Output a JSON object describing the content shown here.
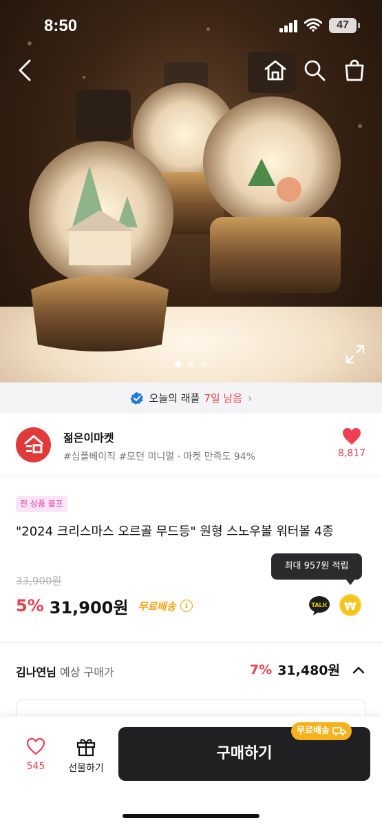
{
  "status": {
    "time": "8:50",
    "battery": "47"
  },
  "hero": {
    "carousel_count": 3,
    "active_index": 0
  },
  "raffle": {
    "text": "오늘의 래플",
    "days_left": "7일 남음"
  },
  "shop": {
    "name": "젊은이마켓",
    "tags": "#심플베이직 #모던 미니멀 · 마켓 만족도 94%",
    "likes": "8,817"
  },
  "product": {
    "promo_badge": "전 상품 블프",
    "title": "\"2024 크리스마스 오르골 무드등\" 원형 스노우볼 워터볼 4종",
    "tooltip": "최대 957원 적립",
    "original_price": "33,900원",
    "discount": "5%",
    "price": "31,900원",
    "shipping": "무료배송",
    "talk_label": "TALK",
    "coin_label": "₩"
  },
  "expected": {
    "name": "김나연님",
    "label": "예상 구매가",
    "discount": "7%",
    "price": "31,480원"
  },
  "bottom": {
    "wish_count": "545",
    "gift_label": "선물하기",
    "buy_label": "구매하기",
    "free_tag": "무료배송"
  },
  "colors": {
    "accent_red": "#e8424f",
    "free_orange": "#f3a312",
    "buy_dark": "#202022"
  }
}
